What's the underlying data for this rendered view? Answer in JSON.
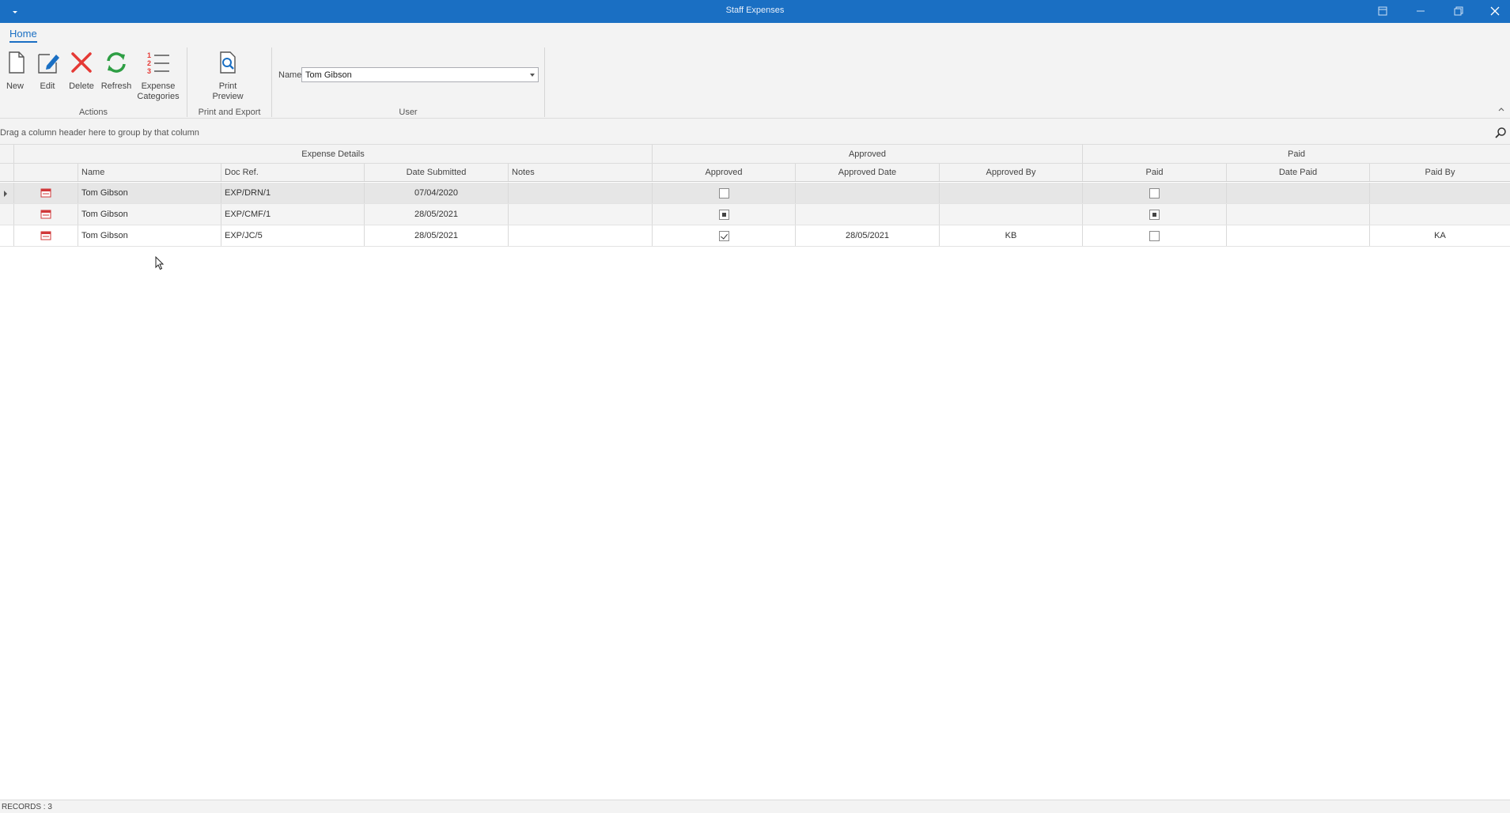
{
  "window": {
    "title": "Staff Expenses"
  },
  "ribbon": {
    "tab": "Home",
    "buttons": {
      "new": "New",
      "edit": "Edit",
      "delete": "Delete",
      "refresh": "Refresh",
      "categories_line1": "Expense",
      "categories_line2": "Categories",
      "print_line1": "Print",
      "print_line2": "Preview"
    },
    "groups": {
      "actions": "Actions",
      "print_export": "Print and Export",
      "user": "User"
    },
    "user": {
      "name_label": "Name",
      "name_value": "Tom Gibson"
    }
  },
  "grid": {
    "group_hint": "Drag a column header here to group by that column",
    "bands": {
      "expense_details": "Expense Details",
      "approved": "Approved",
      "paid": "Paid"
    },
    "columns": {
      "name": "Name",
      "doc_ref": "Doc Ref.",
      "date_submitted": "Date Submitted",
      "notes": "Notes",
      "approved": "Approved",
      "approved_date": "Approved Date",
      "approved_by": "Approved By",
      "paid": "Paid",
      "date_paid": "Date Paid",
      "paid_by": "Paid By"
    },
    "rows": [
      {
        "name": "Tom Gibson",
        "doc_ref": "EXP/DRN/1",
        "date_submitted": "07/04/2020",
        "notes": "",
        "approved": "unchecked",
        "approved_date": "",
        "approved_by": "",
        "paid": "unchecked",
        "date_paid": "",
        "paid_by": ""
      },
      {
        "name": "Tom Gibson",
        "doc_ref": "EXP/CMF/1",
        "date_submitted": "28/05/2021",
        "notes": "",
        "approved": "indeterminate",
        "approved_date": "",
        "approved_by": "",
        "paid": "indeterminate",
        "date_paid": "",
        "paid_by": ""
      },
      {
        "name": "Tom Gibson",
        "doc_ref": "EXP/JC/5",
        "date_submitted": "28/05/2021",
        "notes": "",
        "approved": "checked",
        "approved_date": "28/05/2021",
        "approved_by": "KB",
        "paid": "unchecked",
        "date_paid": "",
        "paid_by": "KA"
      }
    ]
  },
  "status": {
    "records": "RECORDS : 3"
  },
  "colors": {
    "titlebar": "#1a6fc3",
    "ribbon_bg": "#f3f3f3",
    "delete_red": "#e53935",
    "refresh_green": "#2e9e44",
    "accent": "#1a6fc3"
  },
  "icons": [
    "menu-arrow-icon",
    "new-document-icon",
    "edit-icon",
    "delete-icon",
    "refresh-icon",
    "numbered-list-icon",
    "print-preview-icon",
    "expense-row-icon",
    "search-icon"
  ]
}
